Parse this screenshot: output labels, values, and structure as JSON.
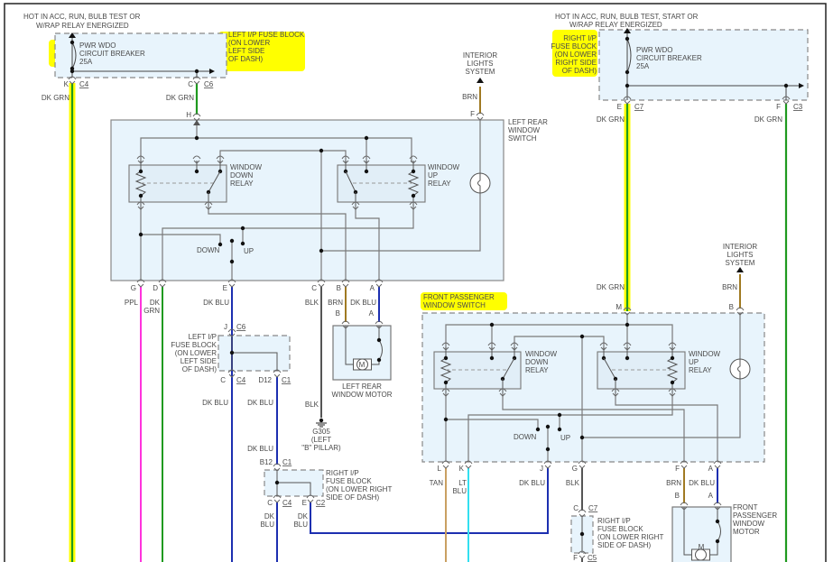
{
  "colors": {
    "dk_grn": "#1f9a1f",
    "dk_blu": "#1c2fb0",
    "ppl": "#ff33dd",
    "brn": "#a07a22",
    "tan": "#c9a062",
    "lt_blu": "#33dff0",
    "blk": "#555555",
    "internal": "#7a7a7a",
    "highlight": "#ffff00",
    "module_fill": "#e8f4fc"
  },
  "left_supply": {
    "hot_note": [
      "HOT IN ACC, RUN, BULB TEST OR",
      "W/RAP RELAY ENERGIZED"
    ],
    "breaker": [
      "PWR WDO",
      "CIRCUIT BREAKER",
      "25A"
    ],
    "fuse_block": [
      "LEFT I/P FUSE BLOCK",
      "(ON LOWER",
      "LEFT SIDE",
      "OF DASH)"
    ],
    "pin_k": "K",
    "conn_c4": "C4",
    "pin_c": "C",
    "conn_c6": "C6",
    "wire_1": "DK GRN",
    "wire_2": "DK GRN"
  },
  "left_rear_switch": {
    "title": [
      "LEFT REAR",
      "WINDOW",
      "SWITCH"
    ],
    "pin_h": "H",
    "pin_f": "F",
    "wire_f": "BRN",
    "interior_lights": [
      "INTERIOR",
      "LIGHTS",
      "SYSTEM"
    ],
    "down_relay": [
      "WINDOW",
      "DOWN",
      "RELAY"
    ],
    "up_relay": [
      "WINDOW",
      "UP",
      "RELAY"
    ],
    "down": "DOWN",
    "up": "UP",
    "pins": [
      "G",
      "D",
      "E",
      "C",
      "B",
      "A"
    ],
    "wires": {
      "g": "PPL",
      "d": [
        "DK",
        "GRN"
      ],
      "e": "DK BLU",
      "c": "BLK",
      "b": "BRN",
      "a": "DK BLU"
    }
  },
  "left_rear_motor": {
    "pin_b": "B",
    "pin_a": "A",
    "motor": "M",
    "title": [
      "LEFT REAR",
      "WINDOW MOTOR"
    ]
  },
  "left_fuse_block_2": {
    "pin_j": "J",
    "conn_c6": "C6",
    "lines": [
      "LEFT I/P",
      "FUSE BLOCK",
      "(ON LOWER",
      "LEFT SIDE",
      "OF DASH)"
    ],
    "pin_c": "C",
    "conn_c4": "C4",
    "pin_d12": "D12",
    "conn_c1": "C1",
    "wire_1": "DK BLU",
    "wire_2": "DK BLU",
    "wire_3": "DK BLU",
    "pin_b12": "B12",
    "conn_c1b": "C1"
  },
  "right_fuse_block_mid": {
    "lines": [
      "RIGHT I/P",
      "FUSE BLOCK",
      "(ON LOWER RIGHT",
      "SIDE OF DASH)"
    ],
    "pin_c": "C",
    "conn_c4": "C4",
    "pin_e": "E",
    "conn_c2": "C2",
    "wire_1": [
      "DK",
      "BLU"
    ],
    "wire_2": [
      "DK",
      "BLU"
    ]
  },
  "ground": {
    "wire": "BLK",
    "id": "G305",
    "location": [
      "(LEFT",
      "\"B\" PILLAR)"
    ]
  },
  "right_supply": {
    "hot_note": [
      "HOT IN ACC, RUN, BULB TEST, START OR",
      "W/RAP RELAY ENERGIZED"
    ],
    "fuse_block": [
      "RIGHT I/P",
      "FUSE BLOCK",
      "(ON LOWER",
      "RIGHT SIDE",
      "OF DASH)"
    ],
    "breaker": [
      "PWR WDO",
      "CIRCUIT BREAKER",
      "25A"
    ],
    "pin_e": "E",
    "conn_c7": "C7",
    "pin_f": "F",
    "conn_c3": "C3",
    "wire_1": "DK GRN",
    "wire_2": "DK GRN"
  },
  "front_passenger_switch": {
    "title": [
      "FRONT PASSENGER",
      "WINDOW SWITCH"
    ],
    "wire_m": "DK GRN",
    "pin_m": "M",
    "interior_lights": [
      "INTERIOR",
      "LIGHTS",
      "SYSTEM"
    ],
    "wire_b": "BRN",
    "pin_b": "B",
    "down_relay": [
      "WINDOW",
      "DOWN",
      "RELAY"
    ],
    "up_relay": [
      "WINDOW",
      "UP",
      "RELAY"
    ],
    "down": "DOWN",
    "up": "UP",
    "pins": [
      "L",
      "K",
      "J",
      "G",
      "F",
      "A"
    ],
    "wires": {
      "l": "TAN",
      "k": [
        "LT",
        "BLU"
      ],
      "j": "DK BLU",
      "g": "BLK",
      "f": "BRN",
      "a": "DK BLU"
    }
  },
  "right_fuse_block_low": {
    "pin_c": "C",
    "conn_c7": "C7",
    "lines": [
      "RIGHT I/P",
      "FUSE BLOCK",
      "(ON LOWER RIGHT",
      "SIDE OF DASH)"
    ],
    "pin_f": "F",
    "conn_c5": "C5"
  },
  "front_passenger_motor": {
    "pin_b": "B",
    "pin_a": "A",
    "motor": "M",
    "title": [
      "FRONT",
      "PASSENGER",
      "WINDOW",
      "MOTOR"
    ]
  }
}
